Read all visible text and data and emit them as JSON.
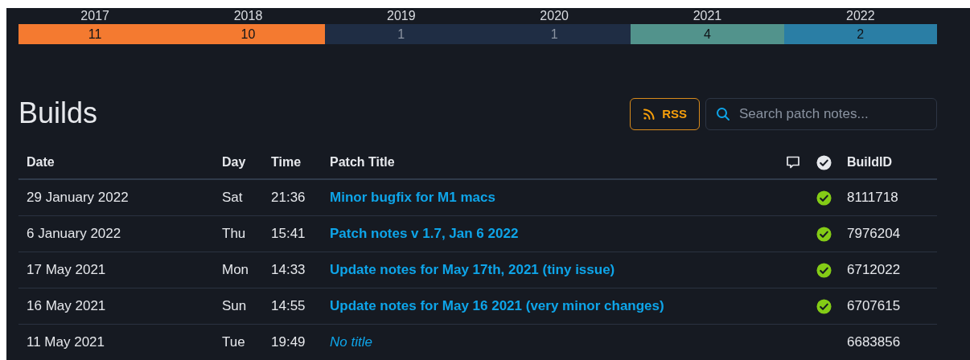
{
  "years": [
    {
      "year": "2017",
      "count": "11",
      "color": "#f47a30"
    },
    {
      "year": "2018",
      "count": "10",
      "color": "#f47a30"
    },
    {
      "year": "2019",
      "count": "1",
      "color": "#1f2d44"
    },
    {
      "year": "2020",
      "count": "1",
      "color": "#1f2d44"
    },
    {
      "year": "2021",
      "count": "4",
      "color": "#52938c"
    },
    {
      "year": "2022",
      "count": "2",
      "color": "#2a7ea5"
    }
  ],
  "heading": "Builds",
  "rss_button": "RSS",
  "search": {
    "placeholder": "Search patch notes..."
  },
  "table": {
    "columns": [
      "Date",
      "Day",
      "Time",
      "Patch Title",
      "BuildID"
    ],
    "rows": [
      {
        "date": "29 January 2022",
        "day": "Sat",
        "time": "21:36",
        "title": "Minor bugfix for M1 macs",
        "kind": "link",
        "verified": true,
        "build_id": "8111718"
      },
      {
        "date": "6 January 2022",
        "day": "Thu",
        "time": "15:41",
        "title": "Patch notes v 1.7, Jan 6 2022",
        "kind": "link",
        "verified": true,
        "build_id": "7976204"
      },
      {
        "date": "17 May 2021",
        "day": "Mon",
        "time": "14:33",
        "title": "Update notes for May 17th, 2021 (tiny issue)",
        "kind": "link",
        "verified": true,
        "build_id": "6712022"
      },
      {
        "date": "16 May 2021",
        "day": "Sun",
        "time": "14:55",
        "title": "Update notes for May 16 2021 (very minor changes)",
        "kind": "link",
        "verified": true,
        "build_id": "6707615"
      },
      {
        "date": "11 May 2021",
        "day": "Tue",
        "time": "19:49",
        "title": "No title",
        "kind": "empty",
        "verified": false,
        "build_id": "6683856"
      }
    ]
  }
}
